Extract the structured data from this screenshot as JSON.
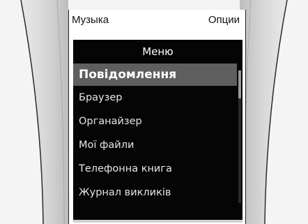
{
  "softkeys": {
    "left": "Музыка",
    "right": "Опции"
  },
  "menu": {
    "title": "Меню",
    "items": [
      {
        "label": "Повідомлення",
        "selected": true
      },
      {
        "label": "Браузер"
      },
      {
        "label": "Органайзер"
      },
      {
        "label": "Мої файли"
      },
      {
        "label": "Телефонна книга"
      },
      {
        "label": "Журнал викликів"
      }
    ],
    "selection_color": "#5e5e5e",
    "background_color": "#050505"
  }
}
